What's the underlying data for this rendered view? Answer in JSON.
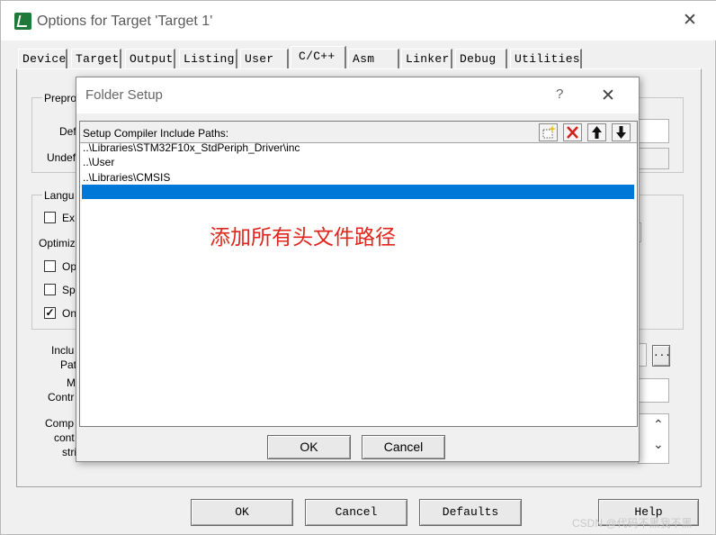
{
  "window": {
    "title": "Options for Target 'Target 1'",
    "close_glyph": "✕"
  },
  "tabs": [
    {
      "label": "Device"
    },
    {
      "label": "Target"
    },
    {
      "label": "Output"
    },
    {
      "label": "Listing"
    },
    {
      "label": "User"
    },
    {
      "label": "C/C++",
      "active": true
    },
    {
      "label": "Asm"
    },
    {
      "label": "Linker"
    },
    {
      "label": "Debug"
    },
    {
      "label": "Utilities"
    }
  ],
  "panel": {
    "preproc_group": "Prepro",
    "define_label": "Def",
    "undefine_label": "Undef",
    "language_group": "Langu",
    "ex_option": "Ex",
    "optimize_label": "Optimiz",
    "op_option": "Op",
    "sp_option": "Sp",
    "on_option": "On",
    "include_label_1": "Inclu",
    "include_label_2": "Pat",
    "misc_label_1": "M",
    "misc_label_2": "Contr",
    "compiler_label_1": "Comp",
    "compiler_label_2": "cont",
    "compiler_label_3": "stri",
    "browse_label": "...",
    "scroll_up": "⌃",
    "scroll_down": "⌄"
  },
  "bottom_buttons": {
    "ok": "OK",
    "cancel": "Cancel",
    "defaults": "Defaults",
    "help": "Help"
  },
  "dialog": {
    "title": "Folder Setup",
    "help_glyph": "?",
    "close_glyph": "✕",
    "list_header": "Setup Compiler Include Paths:",
    "paths": [
      "..\\Libraries\\STM32F10x_StdPeriph_Driver\\inc",
      "..\\User",
      "..\\Libraries\\CMSIS",
      ""
    ],
    "note": "添加所有头文件路径",
    "ok": "OK",
    "cancel": "Cancel"
  },
  "colors": {
    "selection": "#0078d7",
    "note_text": "#e0261c",
    "delete_icon": "#d0201a",
    "new_icon": "#e8c020"
  },
  "watermark": "CSDN @代码不黑我不黑"
}
